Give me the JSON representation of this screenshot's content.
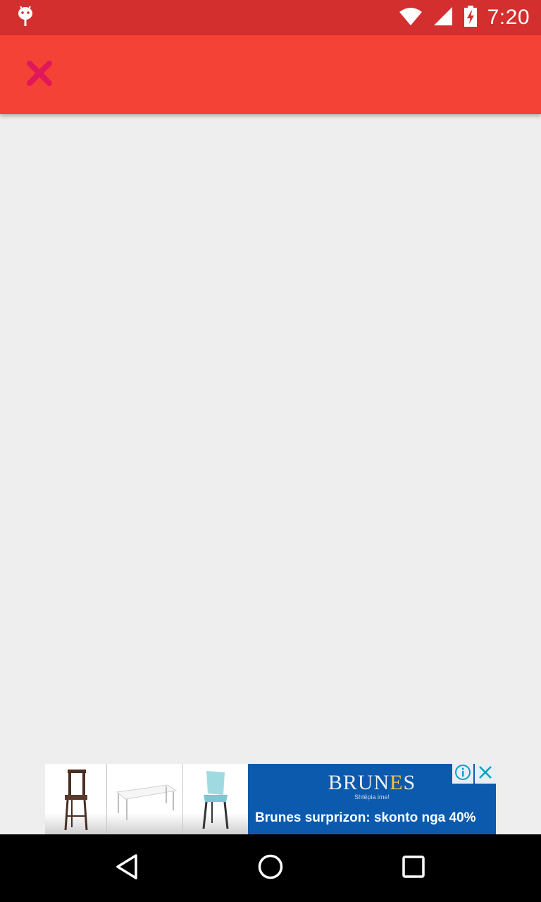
{
  "status_bar": {
    "time": "7:20",
    "icons": [
      "android-icon",
      "wifi-icon",
      "signal-icon",
      "battery-charging-icon"
    ],
    "background": "#d32f2f"
  },
  "toolbar": {
    "background": "#f44336",
    "close_icon": "close-icon",
    "close_icon_color": "#e0185a"
  },
  "ad": {
    "brand_prefix": "BRUN",
    "brand_accent": "E",
    "brand_suffix": "S",
    "tagline": "Shtëpia ime!",
    "headline": "Brunes surprizon: skonto nga 40%",
    "products": [
      "bar-stool",
      "white-table",
      "transparent-chair"
    ],
    "choices_icons": [
      "info-icon",
      "close-icon"
    ],
    "panel_color": "#0b5aad"
  },
  "nav_bar": {
    "buttons": [
      "back-icon",
      "home-icon",
      "recents-icon"
    ]
  }
}
